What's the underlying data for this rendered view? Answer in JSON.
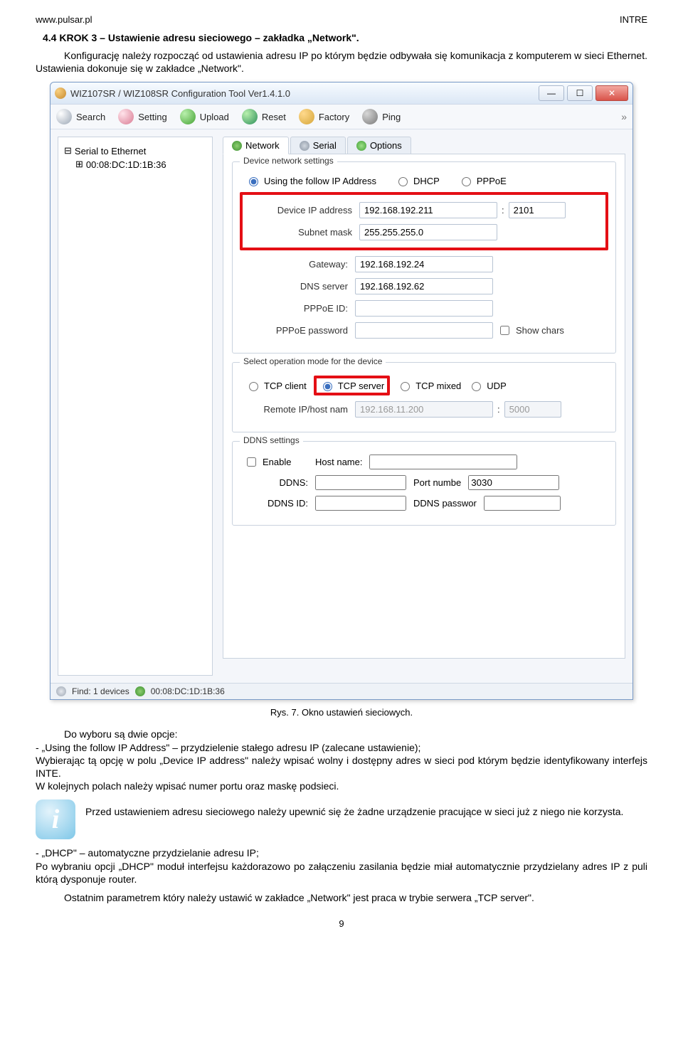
{
  "header": {
    "left": "www.pulsar.pl",
    "right": "INTRE"
  },
  "section_title": "4.4 KROK 3 – Ustawienie adresu sieciowego – zakładka „Network\".",
  "intro": "Konfigurację należy rozpocząć od ustawienia adresu IP po którym będzie odbywała się komunikacja z komputerem w sieci Ethernet. Ustawienia dokonuje się w zakładce „Network\".",
  "win": {
    "title": "WIZ107SR / WIZ108SR Configuration Tool Ver1.4.1.0",
    "toolbar": {
      "search": "Search",
      "setting": "Setting",
      "upload": "Upload",
      "reset": "Reset",
      "factory": "Factory",
      "ping": "Ping"
    },
    "tree": {
      "root": "Serial to Ethernet",
      "child": "00:08:DC:1D:1B:36"
    },
    "tabs": {
      "network": "Network",
      "serial": "Serial",
      "options": "Options"
    },
    "network": {
      "group1_title": "Device network settings",
      "addr_mode": {
        "follow": "Using the follow IP Address",
        "dhcp": "DHCP",
        "pppoe": "PPPoE"
      },
      "labels": {
        "ip": "Device IP address",
        "mask": "Subnet mask",
        "gw": "Gateway:",
        "dns": "DNS server",
        "pppoe_id": "PPPoE ID:",
        "pppoe_pw": "PPPoE password",
        "show_chars": "Show chars"
      },
      "values": {
        "ip": "192.168.192.211",
        "port": "2101",
        "mask": "255.255.255.0",
        "gw": "192.168.192.24",
        "dns": "192.168.192.62"
      },
      "opmode_title": "Select operation mode for the device",
      "opmode": {
        "tcp_client": "TCP client",
        "tcp_server": "TCP server",
        "tcp_mixed": "TCP mixed",
        "udp": "UDP"
      },
      "remote": {
        "label": "Remote IP/host nam",
        "value": "192.168.11.200",
        "port": "5000"
      },
      "ddns_title": "DDNS settings",
      "ddns": {
        "enable": "Enable",
        "host_label": "Host name:",
        "ddns_label": "DDNS:",
        "port_label": "Port numbe",
        "port_value": "3030",
        "id_label": "DDNS ID:",
        "pw_label": "DDNS passwor"
      }
    },
    "status": {
      "find": "Find: 1 devices",
      "mac": "00:08:DC:1D:1B:36"
    }
  },
  "caption": "Rys. 7. Okno ustawień sieciowych.",
  "body1": "Do wyboru są dwie opcje:",
  "body2": "- „Using the follow IP Address\" – przydzielenie stałego adresu IP (zalecane ustawienie);",
  "body3": "Wybierając tą opcję w polu „Device IP address\" należy wpisać wolny i dostępny adres w sieci pod którym będzie identyfikowany interfejs INTE.",
  "body4": "W kolejnych polach należy wpisać numer portu oraz maskę podsieci.",
  "infonote": "Przed ustawieniem adresu sieciowego należy upewnić się że żadne urządzenie pracujące w sieci już z niego nie korzysta.",
  "body5": "- „DHCP\" – automatyczne przydzielanie adresu IP;",
  "body6": "Po wybraniu opcji „DHCP\" moduł interfejsu każdorazowo po załączeniu zasilania będzie miał automatycznie przydzielany adres IP z puli którą dysponuje router.",
  "body7": "Ostatnim parametrem który należy ustawić w zakładce „Network\" jest praca w trybie serwera „TCP server\".",
  "page": "9"
}
